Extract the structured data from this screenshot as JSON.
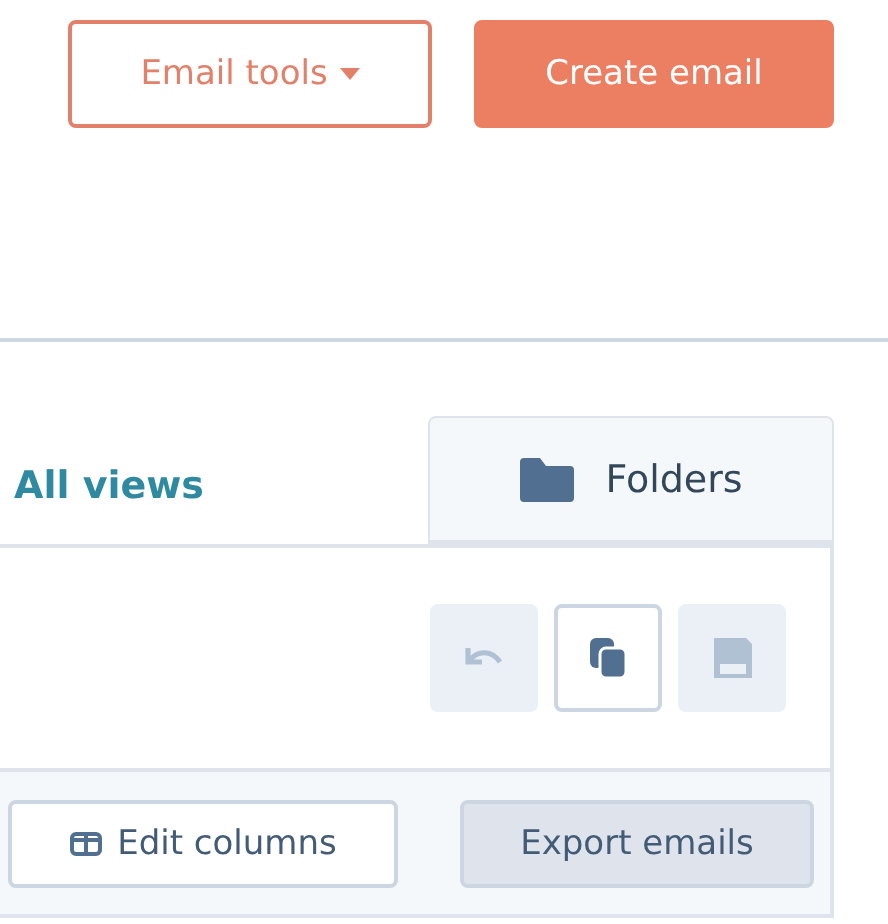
{
  "header_buttons": [
    {
      "label": "Email tools",
      "kind": "dropdown"
    },
    {
      "label": "Create email",
      "kind": "primary"
    }
  ],
  "views_link": "All views",
  "tabs": [
    {
      "label": "Folders",
      "selected": false
    }
  ],
  "view_actions": [
    {
      "kind": "undo",
      "disabled": true
    },
    {
      "kind": "copy",
      "disabled": false
    },
    {
      "kind": "save",
      "disabled": true
    }
  ],
  "table_actions": [
    {
      "label": "Edit columns",
      "kind": "columns"
    },
    {
      "label": "Export emails",
      "kind": "plain"
    }
  ]
}
